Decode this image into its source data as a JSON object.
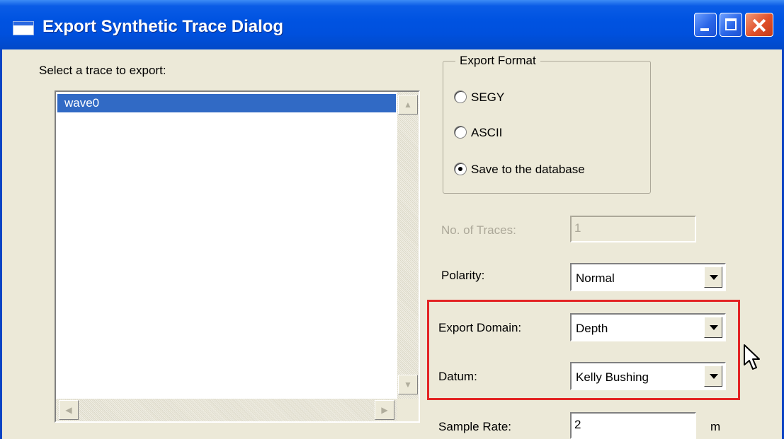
{
  "window": {
    "title": "Export Synthetic Trace Dialog"
  },
  "trace_list": {
    "label": "Select a trace to export:",
    "items": [
      "wave0"
    ],
    "selected": "wave0"
  },
  "export_format": {
    "legend": "Export Format",
    "options": [
      {
        "label": "SEGY",
        "checked": false
      },
      {
        "label": "ASCII",
        "checked": false
      },
      {
        "label": "Save to the database",
        "checked": true
      }
    ]
  },
  "fields": {
    "num_traces": {
      "label": "No. of Traces:",
      "value": "1",
      "enabled": false
    },
    "polarity": {
      "label": "Polarity:",
      "value": "Normal"
    },
    "export_domain": {
      "label": "Export Domain:",
      "value": "Depth"
    },
    "datum": {
      "label": "Datum:",
      "value": "Kelly Bushing"
    },
    "sample_rate": {
      "label": "Sample Rate:",
      "value": "2",
      "unit": "m"
    }
  },
  "colors": {
    "title_bar": "#0054e3",
    "selection": "#316ac5",
    "highlight_box": "#e32424",
    "dialog_bg": "#ece9d8"
  },
  "icons": [
    "app-window-icon",
    "minimize-icon",
    "maximize-icon",
    "close-icon",
    "arrow-up-icon",
    "arrow-down-icon",
    "arrow-left-icon",
    "arrow-right-icon",
    "dropdown-arrow-icon",
    "mouse-cursor-icon"
  ]
}
